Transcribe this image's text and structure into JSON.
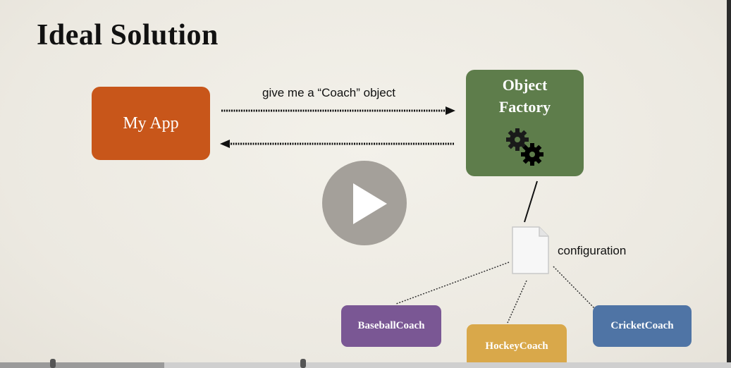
{
  "slide": {
    "title": "Ideal Solution",
    "my_app_label": "My App",
    "factory_label_line1": "Object",
    "factory_label_line2": "Factory",
    "arrow_label": "give me a “Coach” object",
    "config_label": "configuration",
    "coaches": [
      "BaseballCoach",
      "HockeyCoach",
      "CricketCoach"
    ]
  },
  "player": {
    "play_icon": "play-icon",
    "progress_fraction": 0.225
  },
  "colors": {
    "my_app": "#c8561a",
    "factory": "#5e7d4b",
    "baseball": "#7a5794",
    "hockey": "#d9a84a",
    "cricket": "#4f74a5"
  }
}
